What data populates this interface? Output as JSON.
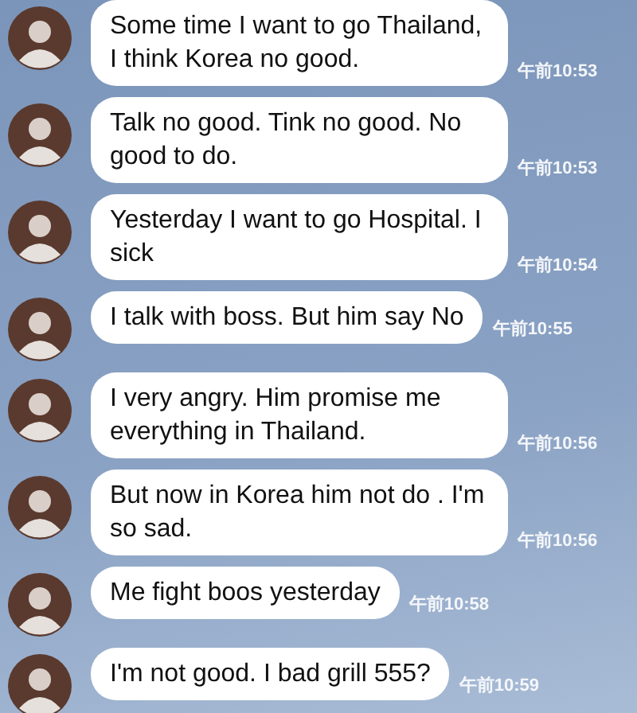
{
  "messages": [
    {
      "text": "Some time I want to go Thailand, I think Korea no good.",
      "time": "午前10:53"
    },
    {
      "text": "Talk no good. Tink no good. No good to do.",
      "time": "午前10:53"
    },
    {
      "text": "Yesterday I want to go Hospital. I sick",
      "time": "午前10:54"
    },
    {
      "text": "I talk with boss. But him say No",
      "time": "午前10:55"
    },
    {
      "text": "I very angry. Him promise me everything in Thailand.",
      "time": "午前10:56"
    },
    {
      "text": "But now in Korea him not do . I'm so sad.",
      "time": "午前10:56"
    },
    {
      "text": "Me fight boos yesterday",
      "time": "午前10:58"
    },
    {
      "text": "I'm not good. I bad grill 555?",
      "time": "午前10:59"
    }
  ]
}
